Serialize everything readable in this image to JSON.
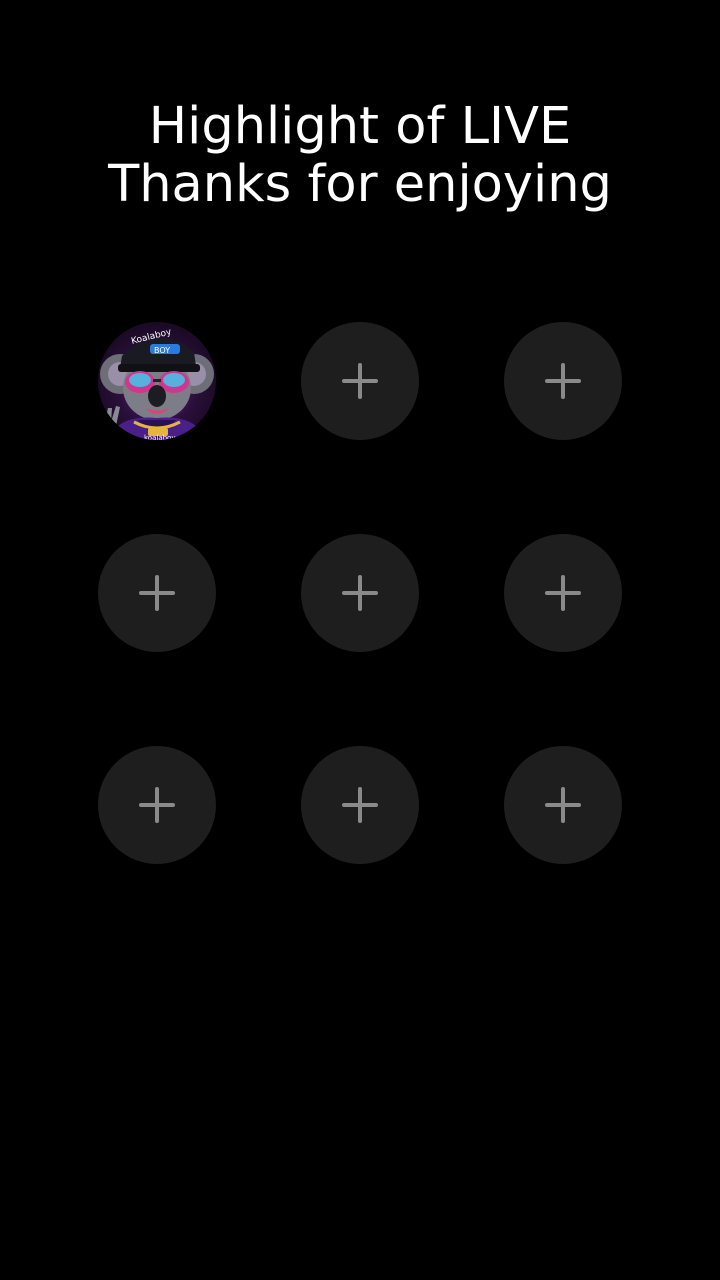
{
  "header": {
    "line1": "Highlight of LIVE",
    "line2": "Thanks for enjoying"
  },
  "avatar": {
    "cap_text_1": "Koalaboy",
    "cap_text_2": "BOY",
    "chain_text": "koalaboy"
  },
  "slots": [
    {
      "type": "avatar"
    },
    {
      "type": "add"
    },
    {
      "type": "add"
    },
    {
      "type": "add"
    },
    {
      "type": "add"
    },
    {
      "type": "add"
    },
    {
      "type": "add"
    },
    {
      "type": "add"
    },
    {
      "type": "add"
    }
  ],
  "colors": {
    "background": "#000000",
    "slot_fill": "#1e1e1e",
    "plus_icon": "#8a8a8a",
    "title_text": "#ffffff"
  }
}
